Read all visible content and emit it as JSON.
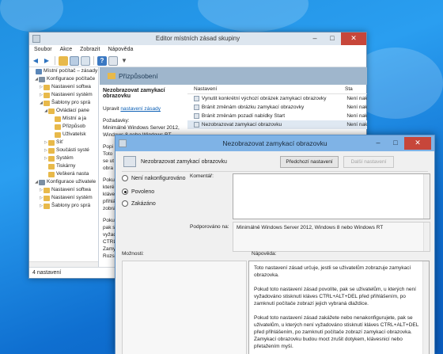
{
  "main_window": {
    "title": "Editor místních zásad skupiny",
    "controls": {
      "minimize": "–",
      "maximize": "□",
      "close": "✕"
    },
    "menu": [
      "Soubor",
      "Akce",
      "Zobrazit",
      "Nápověda"
    ],
    "toolbar_icons": [
      "back-icon",
      "forward-icon",
      "up-folder-icon",
      "show-hide-tree-icon",
      "export-icon",
      "help-icon",
      "properties-icon",
      "filter-icon"
    ],
    "tree": [
      {
        "label": "Místní počítač – zásady",
        "level": 0,
        "icon": "computer-icon"
      },
      {
        "label": "Konfigurace počítače",
        "level": 1,
        "icon": "gear-icon"
      },
      {
        "label": "Nastavení softwa",
        "level": 2,
        "icon": "folder-icon"
      },
      {
        "label": "Nastavení systém",
        "level": 2,
        "icon": "folder-icon"
      },
      {
        "label": "Šablony pro sprá",
        "level": 2,
        "icon": "folder-icon"
      },
      {
        "label": "Ovládací pane",
        "level": 3,
        "icon": "folder-icon"
      },
      {
        "label": "Místní a ja",
        "level": 4,
        "icon": "folder-icon"
      },
      {
        "label": "Přizpůsob",
        "level": 4,
        "icon": "folder-icon"
      },
      {
        "label": "Uživatelsk",
        "level": 4,
        "icon": "folder-icon"
      },
      {
        "label": "Síť",
        "level": 3,
        "icon": "folder-icon"
      },
      {
        "label": "Součásti systé",
        "level": 3,
        "icon": "folder-icon"
      },
      {
        "label": "Systém",
        "level": 3,
        "icon": "folder-icon"
      },
      {
        "label": "Tiskárny",
        "level": 3,
        "icon": "folder-icon"
      },
      {
        "label": "Veškerá nasta",
        "level": 3,
        "icon": "folder-icon"
      },
      {
        "label": "Konfigurace uživatele",
        "level": 1,
        "icon": "gear-icon"
      },
      {
        "label": "Nastavení softwa",
        "level": 2,
        "icon": "folder-icon"
      },
      {
        "label": "Nastavení systém",
        "level": 2,
        "icon": "folder-icon"
      },
      {
        "label": "Šablony pro sprá",
        "level": 2,
        "icon": "folder-icon"
      }
    ],
    "content_header": "Přizpůsobení",
    "description": {
      "title": "Nezobrazovat zamykací obrazovku",
      "edit_prefix": "Upravit",
      "edit_link": "nastavení zásady",
      "requirements_label": "Požadavky:",
      "requirements_text": "Minimálně Windows Server 2012, Windows 8 nebo Windows RT",
      "desc_label": "Popi",
      "desc_lines": [
        "Toto",
        "se ut",
        "obra"
      ],
      "para2_lines": [
        "Pokud",
        "které",
        "kláve",
        "přihlá",
        "zobra"
      ],
      "para3_lines": [
        "Pokud",
        "pak se",
        "vyžad",
        "CTRL+",
        "Zamy",
        "Rozs"
      ]
    },
    "list": {
      "col_name": "Nastavení",
      "col_state": "Sta",
      "rows": [
        {
          "name": "Vynutit konkrétní výchozí obrázek zamykací obrazovky",
          "state": "Není nak"
        },
        {
          "name": "Bránit změnám obrázku zamykací obrazovky",
          "state": "Není nak"
        },
        {
          "name": "Bránit změnám pozadí nabídky Start",
          "state": "Není nak"
        },
        {
          "name": "Nezobrazovat zamykací obrazovku",
          "state": "Není nak"
        }
      ]
    },
    "status": "4 nastavení"
  },
  "dialog": {
    "title": "Nezobrazovat zamykací obrazovku",
    "policy_name": "Nezobrazovat zamykací obrazovku",
    "prev_button": "Předchozí nastavení",
    "next_button": "Další nastavení",
    "options": [
      {
        "label": "Není nakonfigurováno",
        "selected": false
      },
      {
        "label": "Povoleno",
        "selected": true
      },
      {
        "label": "Zakázáno",
        "selected": false
      }
    ],
    "comment_label": "Komentář:",
    "supported_label": "Podporováno na:",
    "supported_value": "Minimálně Windows Server 2012, Windows 8 nebo Windows RT",
    "options_label": "Možnosti:",
    "help_label": "Nápověda:",
    "help_paragraphs": [
      "Toto nastavení zásad určuje, jestli se uživatelům zobrazuje zamykací obrazovka.",
      "Pokud toto nastavení zásad povolíte, pak se uživatelům, u kterých není vyžadováno stisknutí kláves CTRL+ALT+DEL před přihlášením, po zamknutí počítače zobrazí jejich vybraná dlaždice.",
      "Pokud toto nastavení zásad zakážete nebo nenakonfigurujete, pak se uživatelům, u kterých není vyžadováno stisknutí kláves CTRL+ALT+DEL před přihlášením, po zamknutí počítače zobrazí zamykací obrazovka. Zamykací obrazovku budou moct zrušit dotykem, klávesnicí nebo přetažením myší."
    ]
  }
}
